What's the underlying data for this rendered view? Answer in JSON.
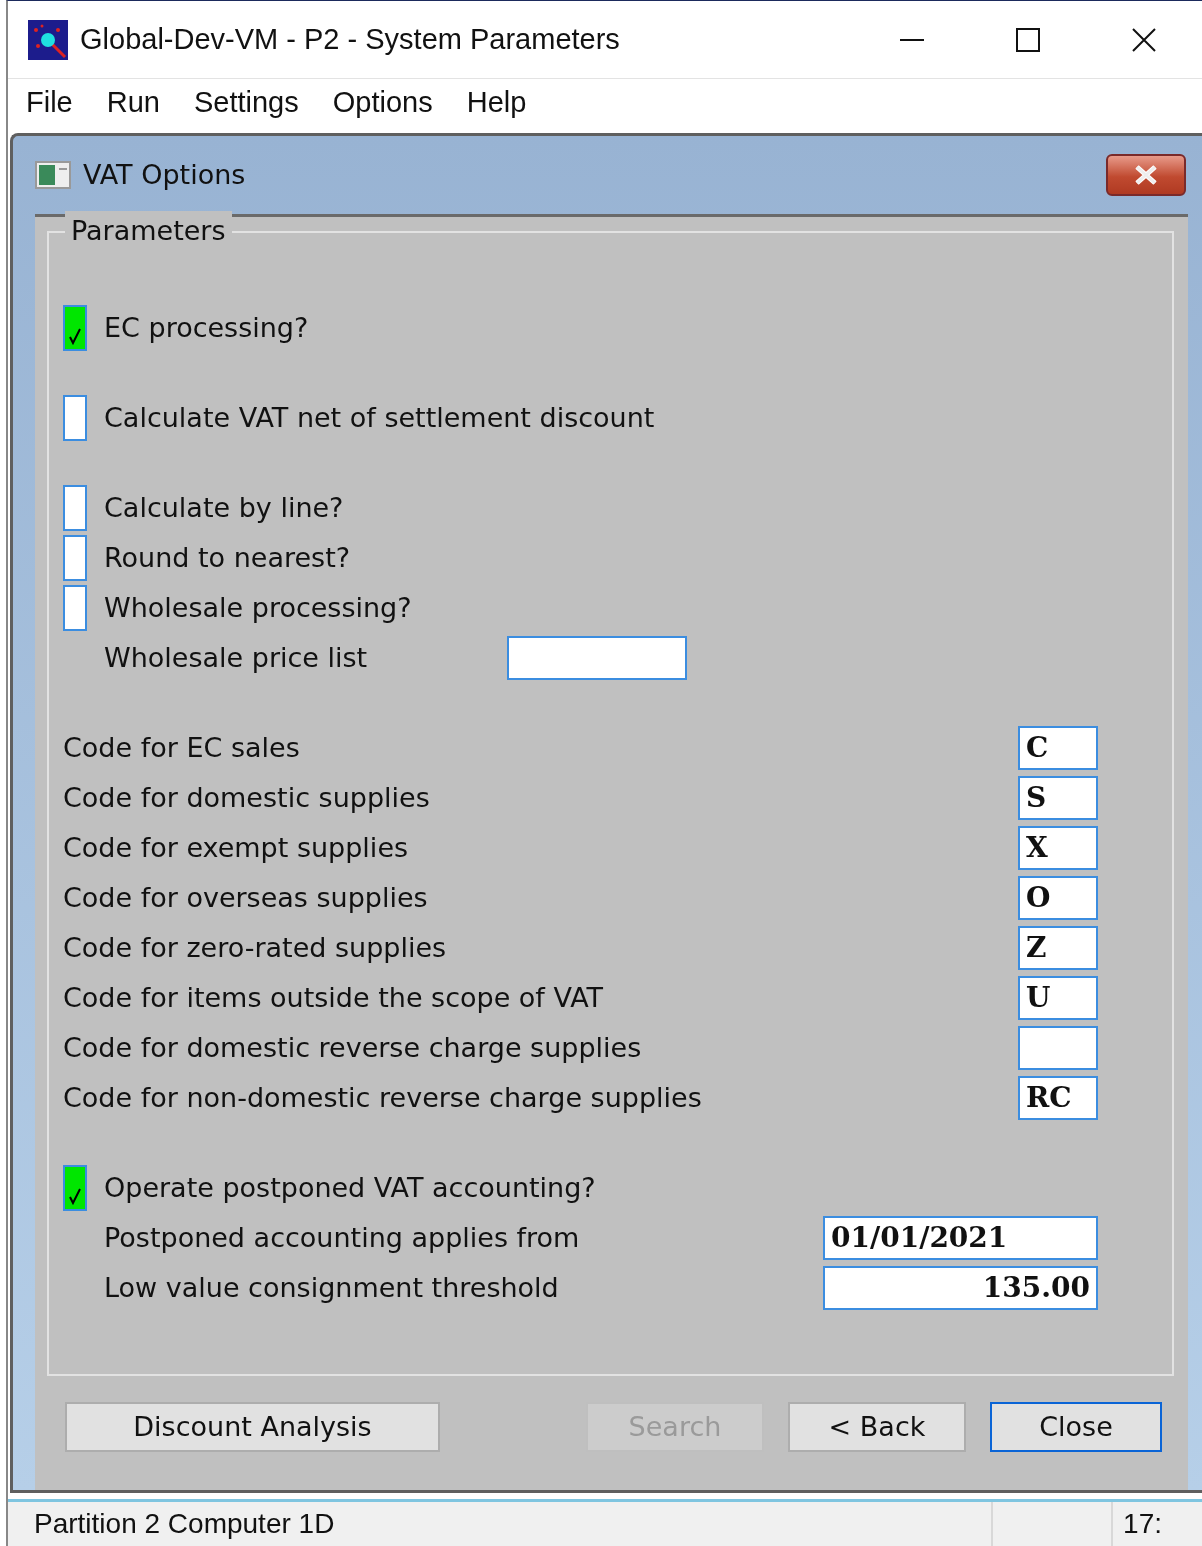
{
  "window": {
    "title": "Global-Dev-VM - P2 - System Parameters"
  },
  "menu": [
    {
      "label": "File"
    },
    {
      "label": "Run"
    },
    {
      "label": "Settings"
    },
    {
      "label": "Options"
    },
    {
      "label": "Help"
    }
  ],
  "dialog": {
    "title": "VAT Options",
    "group": {
      "title": "Parameters",
      "sections": [
        [
          {
            "kind": "check",
            "label": "EC processing?",
            "checked": true
          }
        ],
        [
          {
            "kind": "check",
            "label": "Calculate VAT net of settlement discount",
            "checked": false
          }
        ],
        [
          {
            "kind": "check",
            "label": "Calculate by line?",
            "checked": false
          },
          {
            "kind": "check",
            "label": "Round to nearest?",
            "checked": false
          },
          {
            "kind": "check",
            "label": "Wholesale processing?",
            "checked": false
          },
          {
            "kind": "text",
            "label": "Wholesale price list"
          }
        ],
        [
          {
            "kind": "code",
            "label": "Code for EC sales",
            "value": "C"
          },
          {
            "kind": "code",
            "label": "Code for domestic supplies",
            "value": "S"
          },
          {
            "kind": "code",
            "label": "Code for exempt supplies",
            "value": "X"
          },
          {
            "kind": "code",
            "label": "Code for overseas supplies",
            "value": "O"
          },
          {
            "kind": "code",
            "label": "Code for zero-rated supplies",
            "value": "Z"
          },
          {
            "kind": "code",
            "label": "Code for items outside the scope of VAT",
            "value": "U"
          },
          {
            "kind": "code",
            "label": "Code for domestic reverse charge supplies"
          },
          {
            "kind": "code",
            "label": "Code for non-domestic reverse charge supplies",
            "value": "RC"
          }
        ],
        [
          {
            "kind": "check",
            "label": "Operate postponed VAT accounting?",
            "checked": true
          },
          {
            "kind": "date",
            "label": "Postponed accounting applies from",
            "value": "01/01/2021"
          },
          {
            "kind": "amount",
            "label": "Low value consignment threshold",
            "value": "135.00"
          }
        ]
      ]
    },
    "buttons": [
      {
        "label": "Discount Analysis",
        "disabled": false,
        "focused": false
      },
      {
        "label": "Search",
        "disabled": true,
        "focused": false
      },
      {
        "label": "< Back",
        "disabled": false,
        "focused": false
      },
      {
        "label": "Close",
        "disabled": false,
        "focused": true
      }
    ]
  },
  "status_bar": {
    "message": "Partition 2 Computer 1D",
    "time": "17:"
  }
}
